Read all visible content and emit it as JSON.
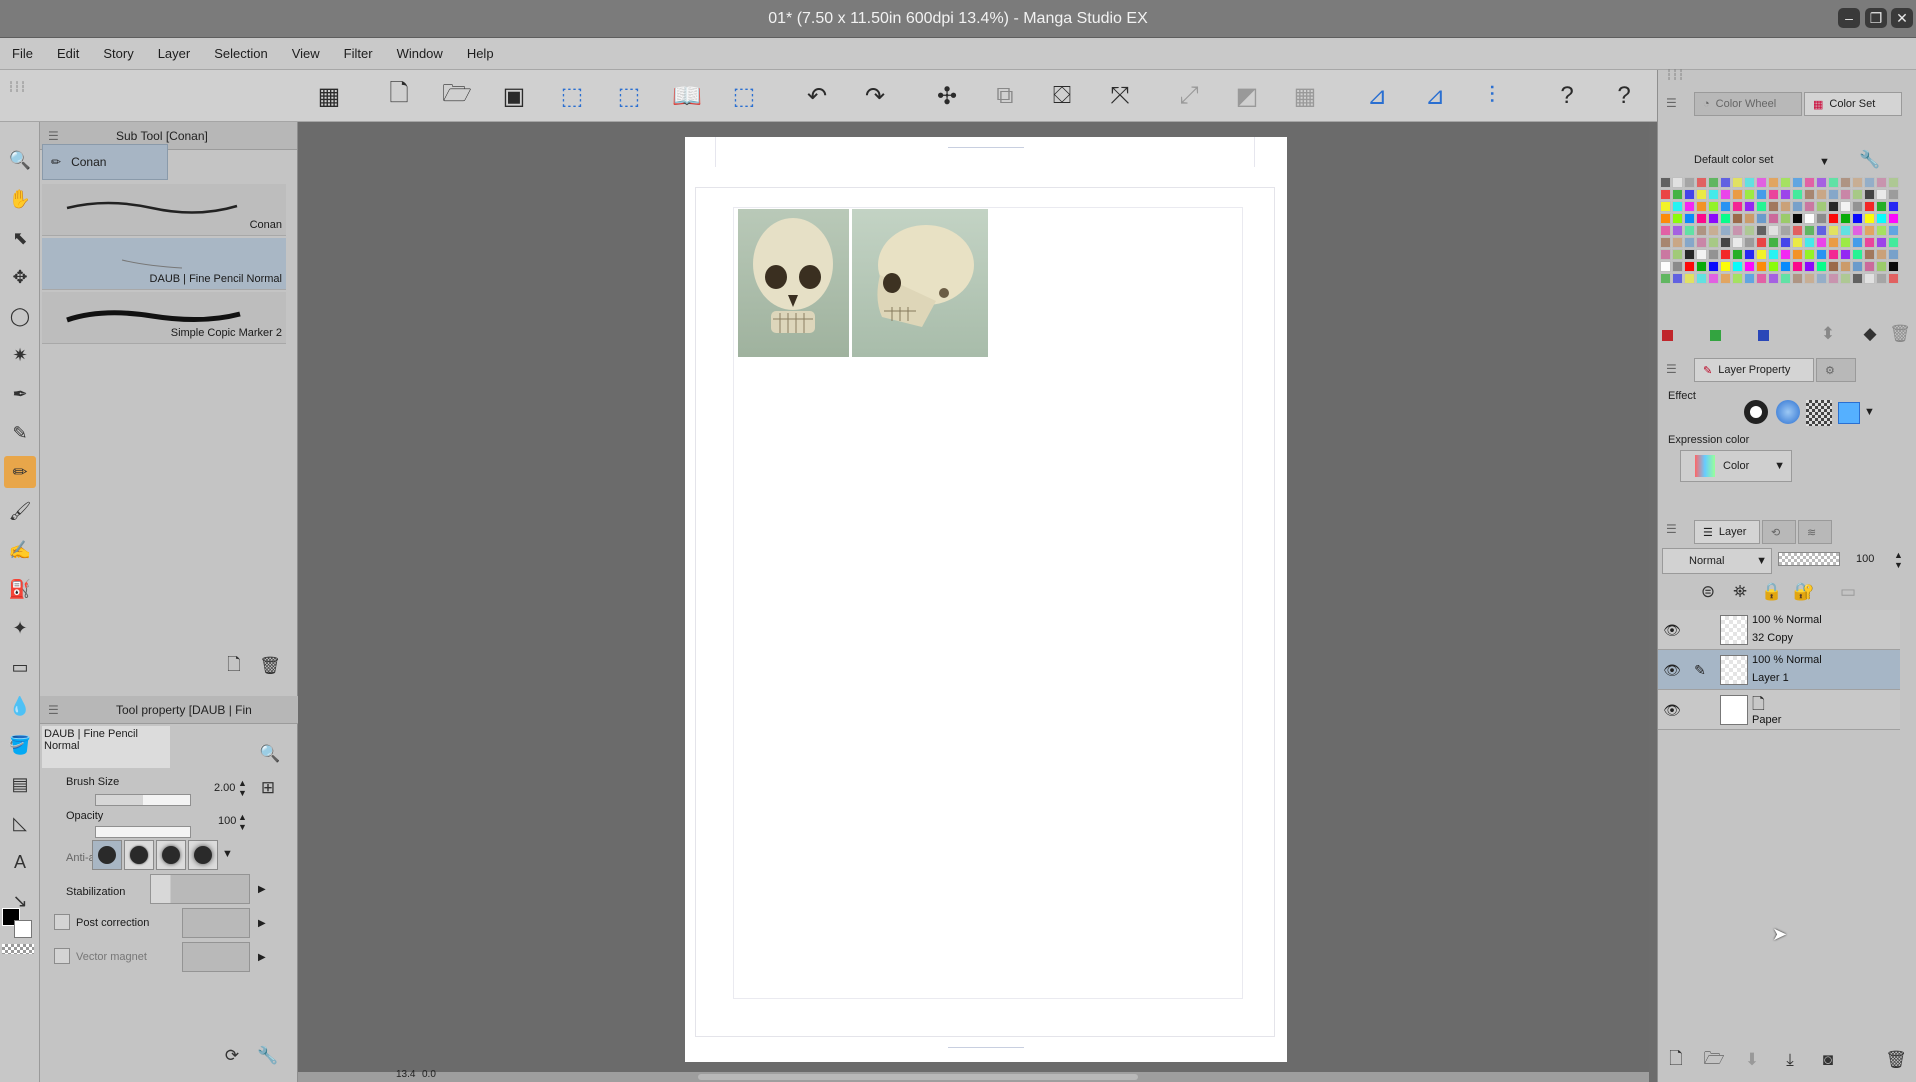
{
  "window": {
    "title": "01* (7.50 x 11.50in 600dpi 13.4%)  - Manga Studio EX"
  },
  "menu": [
    "File",
    "Edit",
    "Story",
    "Layer",
    "Selection",
    "View",
    "Filter",
    "Window",
    "Help"
  ],
  "sub_tool": {
    "header": "Sub Tool [Conan]",
    "group": "Conan",
    "brushes": [
      {
        "name": "Conan",
        "selected": false
      },
      {
        "name": "DAUB | Fine Pencil Normal",
        "selected": true
      },
      {
        "name": "Simple Copic Marker 2",
        "selected": false
      }
    ]
  },
  "tool_property": {
    "header": "Tool property [DAUB | Fin",
    "brush": "DAUB | Fine Pencil Normal",
    "brush_size_label": "Brush Size",
    "brush_size": "2.00",
    "opacity_label": "Opacity",
    "opacity": "100",
    "antialias_label": "Anti-alia",
    "stabilization_label": "Stabilization",
    "post_correction_label": "Post correction",
    "vector_magnet_label": "Vector magnet"
  },
  "color_set": {
    "tabs": [
      "Color Wheel",
      "Color Set"
    ],
    "set_name": "Default color set",
    "selected_colors": [
      "#c0262b",
      "#33a440",
      "#2a47b8"
    ]
  },
  "layer_property": {
    "tab": "Layer Property",
    "effect_label": "Effect",
    "expression_label": "Expression color",
    "expression_value": "Color"
  },
  "layers": {
    "tab": "Layer",
    "blend": "Normal",
    "opacity": "100",
    "items": [
      {
        "line1": "100 %  Normal",
        "line2": "32 Copy",
        "selected": false,
        "editing": false
      },
      {
        "line1": "100 %  Normal",
        "line2": "Layer 1",
        "selected": true,
        "editing": true
      },
      {
        "line1": "",
        "line2": "Paper",
        "selected": false,
        "editing": false
      }
    ]
  },
  "status": {
    "zoom": "13.4",
    "angle": "0.0"
  },
  "colors": {
    "accent_tool": "#e8a64a",
    "selection": "#a6b6c6"
  }
}
